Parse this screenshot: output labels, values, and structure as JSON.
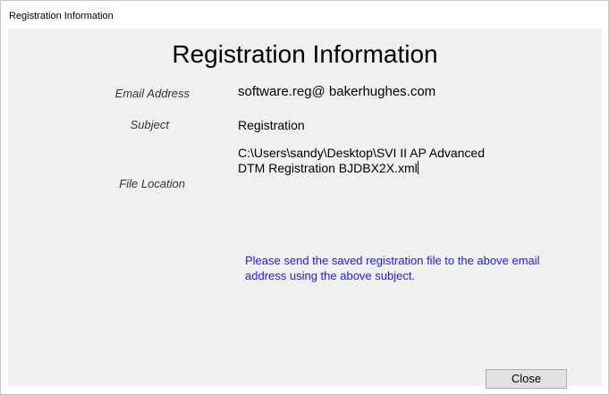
{
  "window": {
    "title": "Registration Information"
  },
  "main": {
    "heading": "Registration Information",
    "fields": {
      "email_label": "Email Address",
      "email_value": "software.reg@ bakerhughes.com",
      "subject_label": "Subject",
      "subject_value": "Registration",
      "file_label": "File Location",
      "file_value_line1": "C:\\Users\\sandy\\Desktop\\SVI II AP Advanced",
      "file_value_line2": "DTM Registration BJDBX2X.xml"
    },
    "note": "Please send the saved registration file to the above email address using the above subject."
  },
  "buttons": {
    "close_label": "Close"
  },
  "colors": {
    "note_text": "#1a1aff",
    "client_background": "#f0f0f0"
  }
}
